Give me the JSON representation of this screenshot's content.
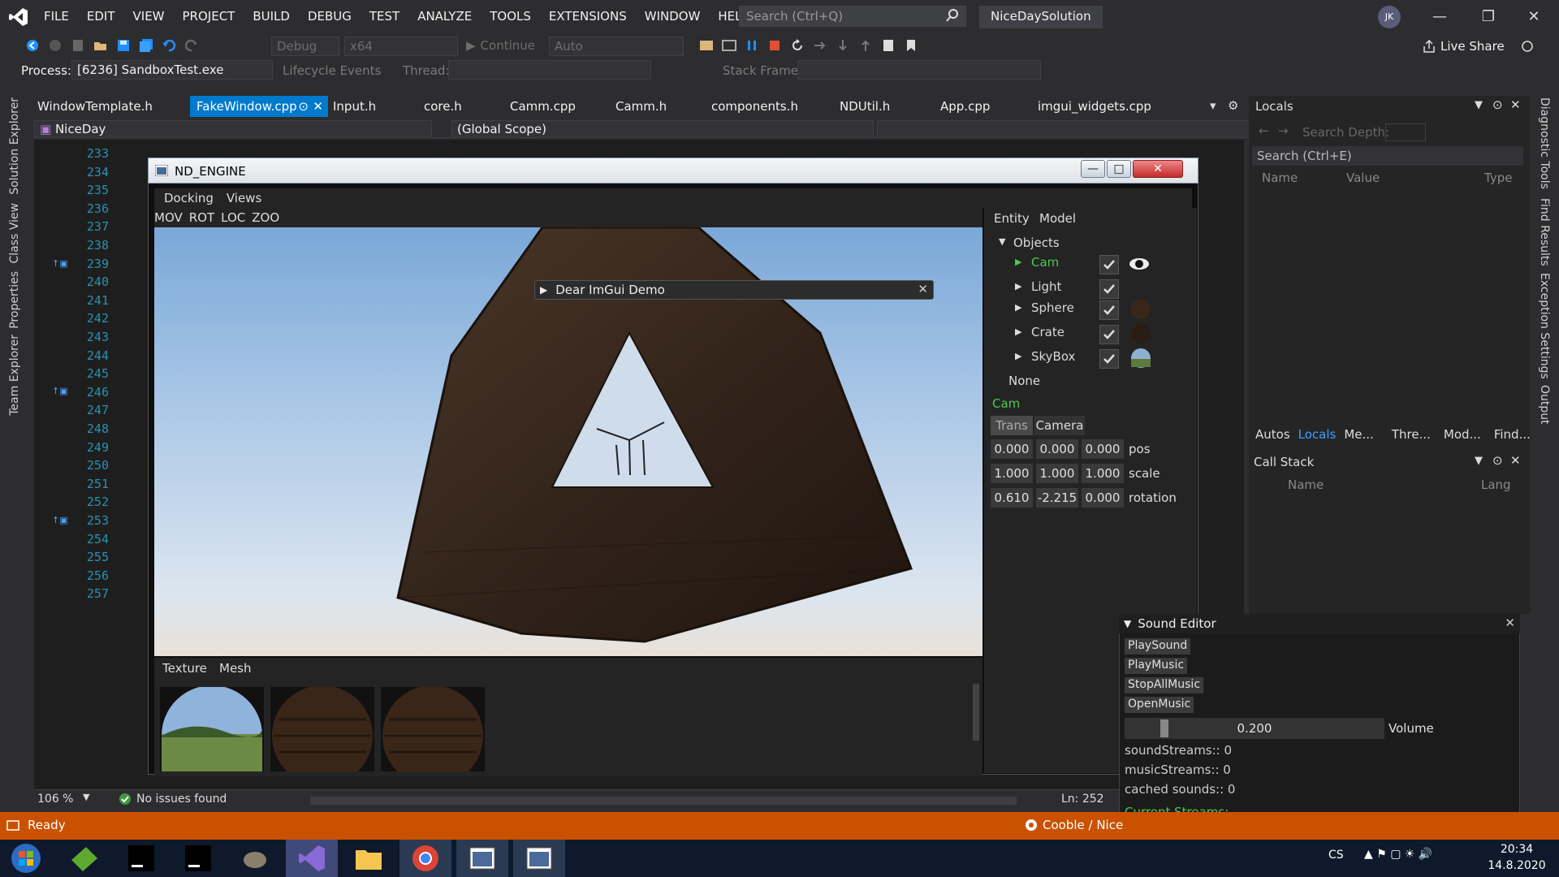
{
  "menu": {
    "items": [
      "FILE",
      "EDIT",
      "VIEW",
      "PROJECT",
      "BUILD",
      "DEBUG",
      "TEST",
      "ANALYZE",
      "TOOLS",
      "EXTENSIONS",
      "WINDOW",
      "HELP"
    ],
    "search_placeholder": "Search (Ctrl+Q)",
    "solution_name": "NiceDaySolution",
    "avatar_initials": "JK"
  },
  "toolbar": {
    "config": "Debug",
    "platform": "x64",
    "continue_label": "Continue",
    "auto_label": "Auto",
    "live_share": "Live Share"
  },
  "debug_location": {
    "process_label": "Process:",
    "process_value": "[6236] SandboxTest.exe",
    "lifecycle_label": "Lifecycle Events",
    "thread_label": "Thread:",
    "stack_frame_label": "Stack Frame:"
  },
  "left_tabs": [
    "Solution Explorer",
    "Class View",
    "Properties",
    "Team Explorer"
  ],
  "right_tabs": [
    "Diagnostic Tools",
    "Find Results",
    "Exception Settings",
    "Output"
  ],
  "doc_tabs": [
    "WindowTemplate.h",
    "FakeWindow.cpp",
    "Input.h",
    "core.h",
    "Camm.cpp",
    "Camm.h",
    "components.h",
    "NDUtil.h",
    "App.cpp",
    "imgui_widgets.cpp"
  ],
  "navbar": {
    "project": "NiceDay",
    "scope": "(Global Scope)"
  },
  "lines": [
    "233",
    "234",
    "235",
    "236",
    "237",
    "238",
    "239",
    "240",
    "241",
    "242",
    "243",
    "244",
    "245",
    "246",
    "247",
    "248",
    "249",
    "250",
    "251",
    "252",
    "253",
    "254",
    "255",
    "256",
    "257"
  ],
  "engine": {
    "title": "ND_ENGINE",
    "menu": [
      "Docking",
      "Views"
    ],
    "modes": [
      "MOV",
      "ROT",
      "LOC",
      "ZOO"
    ],
    "imgui_demo": "Dear ImGui Demo",
    "panel_tabs": [
      "Entity",
      "Model"
    ],
    "objects_label": "Objects",
    "objects": [
      "Cam",
      "Light",
      "Sphere",
      "Crate",
      "SkyBox"
    ],
    "none_label": "None",
    "selected": "Cam",
    "comp_tabs": [
      "Trans",
      "Camera"
    ],
    "transform": {
      "pos": [
        "0.000",
        "0.000",
        "0.000"
      ],
      "scale": [
        "1.000",
        "1.000",
        "1.000"
      ],
      "rotation": [
        "0.610",
        "-2.215",
        "0.000"
      ]
    },
    "transform_labels": [
      "pos",
      "scale",
      "rotation"
    ],
    "asset_tabs": [
      "Texture",
      "Mesh"
    ]
  },
  "locals": {
    "title": "Locals",
    "search_depth": "Search Depth:",
    "search": "Search (Ctrl+E)",
    "cols": [
      "Name",
      "Value",
      "Type"
    ],
    "bottom_tabs": [
      "Autos",
      "Locals",
      "Me...",
      "Thre...",
      "Mod...",
      "Find..."
    ]
  },
  "callstack": {
    "title": "Call Stack",
    "cols": [
      "Name",
      "Lang"
    ]
  },
  "sound": {
    "title": "Sound Editor",
    "buttons": [
      "PlaySound",
      "PlayMusic",
      "StopAllMusic",
      "OpenMusic"
    ],
    "volume_value": "0.200",
    "volume_level": 0.2,
    "volume_label": "Volume",
    "sound_streams": "soundStreams:: 0",
    "music_streams": "musicStreams:: 0",
    "cached": "cached sounds:: 0",
    "current": "Current Streams:"
  },
  "status": {
    "zoom": "106 %",
    "issues": "No issues found",
    "ln": "Ln: 252",
    "ready": "Ready",
    "repo": "Cooble / Nice"
  },
  "taskbar": {
    "lang": "CS",
    "time": "20:34",
    "date": "14.8.2020"
  },
  "colors": {
    "accent": "#007acc",
    "status": "#ca5100",
    "imgui_green": "#4ec94e"
  }
}
